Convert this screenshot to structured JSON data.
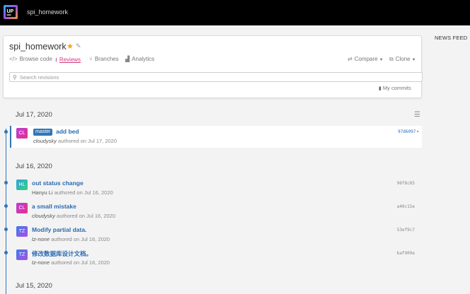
{
  "app": {
    "title": "spi_homework",
    "logo_text": "UP"
  },
  "news_feed_label": "NEWS FEED",
  "repo": {
    "name": "spi_homework",
    "nav": [
      {
        "icon": "</>",
        "label": "Browse code"
      },
      {
        "icon": "⭳",
        "label": "Reviews",
        "active": true
      },
      {
        "icon": "⑂",
        "label": "Branches"
      },
      {
        "icon": "▟",
        "label": "Analytics"
      }
    ],
    "compare_label": "Compare",
    "clone_label": "Clone",
    "search_placeholder": "Search revisions",
    "my_commits_label": "My commits"
  },
  "timeline": [
    {
      "date": "Jul 17, 2020",
      "commits": [
        {
          "avatar": "CL",
          "avatar_style": "cl",
          "branch": "master",
          "title": "add bed",
          "author": "cloudysky",
          "author_italic": true,
          "meta": "authored on Jul 17, 2020",
          "hash": "97d6097",
          "selected": true
        }
      ]
    },
    {
      "date": "Jul 16, 2020",
      "commits": [
        {
          "avatar": "HL",
          "avatar_style": "hl",
          "title": "out status change",
          "author": "Hanyu Li",
          "author_italic": false,
          "meta": "authored on Jul 16, 2020",
          "hash": "96f8c85"
        },
        {
          "avatar": "CL",
          "avatar_style": "cl",
          "title": "a small mistake",
          "author": "cloudysky",
          "author_italic": true,
          "meta": "authored on Jul 16, 2020",
          "hash": "a40c15e"
        },
        {
          "avatar": "TZ",
          "avatar_style": "tz",
          "title": "Modify partial data.",
          "author": "tz-none",
          "author_italic": true,
          "meta": "authored on Jul 16, 2020",
          "hash": "53ef9c7"
        },
        {
          "avatar": "TZ",
          "avatar_style": "tz",
          "title": "修改数据库设计文档。",
          "author": "tz-none",
          "author_italic": true,
          "meta": "authored on Jul 16, 2020",
          "hash": "baf909e"
        }
      ]
    },
    {
      "date": "Jul 15, 2020",
      "commits": []
    }
  ],
  "colors": {
    "accent": "#2f76b8",
    "active_tab": "#d33b7b",
    "star": "#f2a900"
  }
}
